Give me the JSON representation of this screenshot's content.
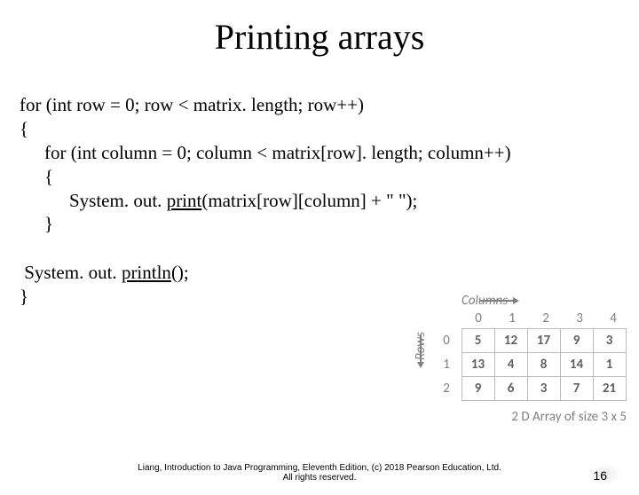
{
  "title": "Printing arrays",
  "code": {
    "l1": "for (int row = 0; row < matrix. length; row++)",
    "l2": "{",
    "l3": "for (int column = 0; column < matrix[row]. length; column++)",
    "l4": "{",
    "l5_a": "System. out. ",
    "l5_b": "print",
    "l5_c": "(matrix[row][column] + \" \");",
    "l6": "}",
    "l7_a": " System. out. ",
    "l7_b": "println",
    "l7_c": "();",
    "l8": "}"
  },
  "diagram": {
    "columns_label": "Columns",
    "rows_label": "Rows",
    "col_idx": [
      "0",
      "1",
      "2",
      "3",
      "4"
    ],
    "row_idx": [
      "0",
      "1",
      "2"
    ],
    "cells": [
      [
        "5",
        "12",
        "17",
        "9",
        "3"
      ],
      [
        "13",
        "4",
        "8",
        "14",
        "1"
      ],
      [
        "9",
        "6",
        "3",
        "7",
        "21"
      ]
    ],
    "caption": "2 D Array of size 3 x 5"
  },
  "footer": {
    "line1": "Liang, Introduction to Java Programming, Eleventh Edition, (c) 2018 Pearson Education, Ltd.",
    "line2": "All rights reserved."
  },
  "pagenum": "16"
}
